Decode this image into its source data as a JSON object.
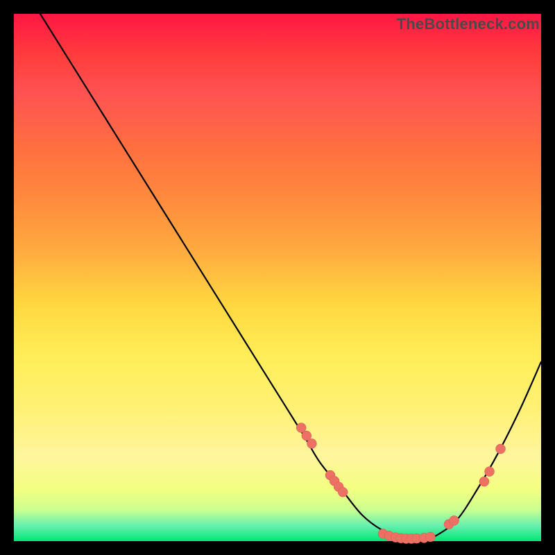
{
  "watermark": "TheBottleneck.com",
  "colors": {
    "background": "#000000",
    "curve": "#000000",
    "marker_fill": "#ec7063",
    "marker_stroke": "#d65a50"
  },
  "chart_data": {
    "type": "line",
    "title": "",
    "xlabel": "",
    "ylabel": "",
    "xlim": [
      0,
      100
    ],
    "ylim": [
      0,
      100
    ],
    "curve": {
      "x": [
        5,
        10,
        15,
        20,
        25,
        30,
        35,
        40,
        45,
        50,
        55,
        58,
        62,
        66,
        70,
        74,
        78,
        80,
        84,
        88,
        92,
        96,
        100
      ],
      "y": [
        100,
        92,
        84,
        76,
        68,
        60,
        52,
        44,
        36,
        28,
        20,
        15,
        10,
        5,
        2,
        0.5,
        0.5,
        1,
        4,
        10,
        17,
        25,
        34
      ]
    },
    "markers": [
      {
        "x": 54.5,
        "y": 21.5
      },
      {
        "x": 55.5,
        "y": 20.0
      },
      {
        "x": 56.5,
        "y": 18.5
      },
      {
        "x": 60.0,
        "y": 12.5
      },
      {
        "x": 60.8,
        "y": 11.4
      },
      {
        "x": 61.6,
        "y": 10.3
      },
      {
        "x": 62.4,
        "y": 9.3
      },
      {
        "x": 70.0,
        "y": 1.4
      },
      {
        "x": 71.2,
        "y": 1.0
      },
      {
        "x": 72.4,
        "y": 0.7
      },
      {
        "x": 73.4,
        "y": 0.55
      },
      {
        "x": 74.4,
        "y": 0.45
      },
      {
        "x": 75.4,
        "y": 0.45
      },
      {
        "x": 76.4,
        "y": 0.5
      },
      {
        "x": 77.8,
        "y": 0.6
      },
      {
        "x": 79.0,
        "y": 0.8
      },
      {
        "x": 82.5,
        "y": 3.2
      },
      {
        "x": 83.5,
        "y": 3.9
      },
      {
        "x": 89.2,
        "y": 11.3
      },
      {
        "x": 90.2,
        "y": 13.2
      },
      {
        "x": 92.3,
        "y": 17.5
      }
    ]
  }
}
